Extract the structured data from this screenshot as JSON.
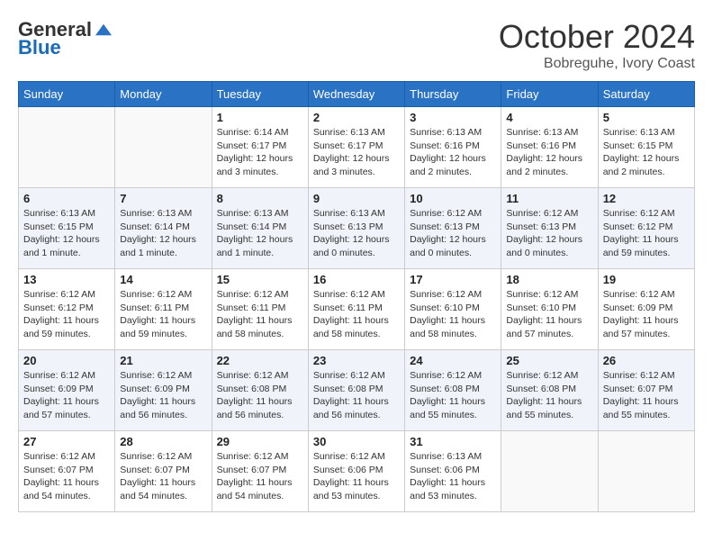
{
  "logo": {
    "general": "General",
    "blue": "Blue"
  },
  "title": {
    "month": "October 2024",
    "location": "Bobreguhe, Ivory Coast"
  },
  "days_of_week": [
    "Sunday",
    "Monday",
    "Tuesday",
    "Wednesday",
    "Thursday",
    "Friday",
    "Saturday"
  ],
  "weeks": [
    [
      {
        "day": "",
        "info": ""
      },
      {
        "day": "",
        "info": ""
      },
      {
        "day": "1",
        "info": "Sunrise: 6:14 AM\nSunset: 6:17 PM\nDaylight: 12 hours and 3 minutes."
      },
      {
        "day": "2",
        "info": "Sunrise: 6:13 AM\nSunset: 6:17 PM\nDaylight: 12 hours and 3 minutes."
      },
      {
        "day": "3",
        "info": "Sunrise: 6:13 AM\nSunset: 6:16 PM\nDaylight: 12 hours and 2 minutes."
      },
      {
        "day": "4",
        "info": "Sunrise: 6:13 AM\nSunset: 6:16 PM\nDaylight: 12 hours and 2 minutes."
      },
      {
        "day": "5",
        "info": "Sunrise: 6:13 AM\nSunset: 6:15 PM\nDaylight: 12 hours and 2 minutes."
      }
    ],
    [
      {
        "day": "6",
        "info": "Sunrise: 6:13 AM\nSunset: 6:15 PM\nDaylight: 12 hours and 1 minute."
      },
      {
        "day": "7",
        "info": "Sunrise: 6:13 AM\nSunset: 6:14 PM\nDaylight: 12 hours and 1 minute."
      },
      {
        "day": "8",
        "info": "Sunrise: 6:13 AM\nSunset: 6:14 PM\nDaylight: 12 hours and 1 minute."
      },
      {
        "day": "9",
        "info": "Sunrise: 6:13 AM\nSunset: 6:13 PM\nDaylight: 12 hours and 0 minutes."
      },
      {
        "day": "10",
        "info": "Sunrise: 6:12 AM\nSunset: 6:13 PM\nDaylight: 12 hours and 0 minutes."
      },
      {
        "day": "11",
        "info": "Sunrise: 6:12 AM\nSunset: 6:13 PM\nDaylight: 12 hours and 0 minutes."
      },
      {
        "day": "12",
        "info": "Sunrise: 6:12 AM\nSunset: 6:12 PM\nDaylight: 11 hours and 59 minutes."
      }
    ],
    [
      {
        "day": "13",
        "info": "Sunrise: 6:12 AM\nSunset: 6:12 PM\nDaylight: 11 hours and 59 minutes."
      },
      {
        "day": "14",
        "info": "Sunrise: 6:12 AM\nSunset: 6:11 PM\nDaylight: 11 hours and 59 minutes."
      },
      {
        "day": "15",
        "info": "Sunrise: 6:12 AM\nSunset: 6:11 PM\nDaylight: 11 hours and 58 minutes."
      },
      {
        "day": "16",
        "info": "Sunrise: 6:12 AM\nSunset: 6:11 PM\nDaylight: 11 hours and 58 minutes."
      },
      {
        "day": "17",
        "info": "Sunrise: 6:12 AM\nSunset: 6:10 PM\nDaylight: 11 hours and 58 minutes."
      },
      {
        "day": "18",
        "info": "Sunrise: 6:12 AM\nSunset: 6:10 PM\nDaylight: 11 hours and 57 minutes."
      },
      {
        "day": "19",
        "info": "Sunrise: 6:12 AM\nSunset: 6:09 PM\nDaylight: 11 hours and 57 minutes."
      }
    ],
    [
      {
        "day": "20",
        "info": "Sunrise: 6:12 AM\nSunset: 6:09 PM\nDaylight: 11 hours and 57 minutes."
      },
      {
        "day": "21",
        "info": "Sunrise: 6:12 AM\nSunset: 6:09 PM\nDaylight: 11 hours and 56 minutes."
      },
      {
        "day": "22",
        "info": "Sunrise: 6:12 AM\nSunset: 6:08 PM\nDaylight: 11 hours and 56 minutes."
      },
      {
        "day": "23",
        "info": "Sunrise: 6:12 AM\nSunset: 6:08 PM\nDaylight: 11 hours and 56 minutes."
      },
      {
        "day": "24",
        "info": "Sunrise: 6:12 AM\nSunset: 6:08 PM\nDaylight: 11 hours and 55 minutes."
      },
      {
        "day": "25",
        "info": "Sunrise: 6:12 AM\nSunset: 6:08 PM\nDaylight: 11 hours and 55 minutes."
      },
      {
        "day": "26",
        "info": "Sunrise: 6:12 AM\nSunset: 6:07 PM\nDaylight: 11 hours and 55 minutes."
      }
    ],
    [
      {
        "day": "27",
        "info": "Sunrise: 6:12 AM\nSunset: 6:07 PM\nDaylight: 11 hours and 54 minutes."
      },
      {
        "day": "28",
        "info": "Sunrise: 6:12 AM\nSunset: 6:07 PM\nDaylight: 11 hours and 54 minutes."
      },
      {
        "day": "29",
        "info": "Sunrise: 6:12 AM\nSunset: 6:07 PM\nDaylight: 11 hours and 54 minutes."
      },
      {
        "day": "30",
        "info": "Sunrise: 6:12 AM\nSunset: 6:06 PM\nDaylight: 11 hours and 53 minutes."
      },
      {
        "day": "31",
        "info": "Sunrise: 6:13 AM\nSunset: 6:06 PM\nDaylight: 11 hours and 53 minutes."
      },
      {
        "day": "",
        "info": ""
      },
      {
        "day": "",
        "info": ""
      }
    ]
  ]
}
